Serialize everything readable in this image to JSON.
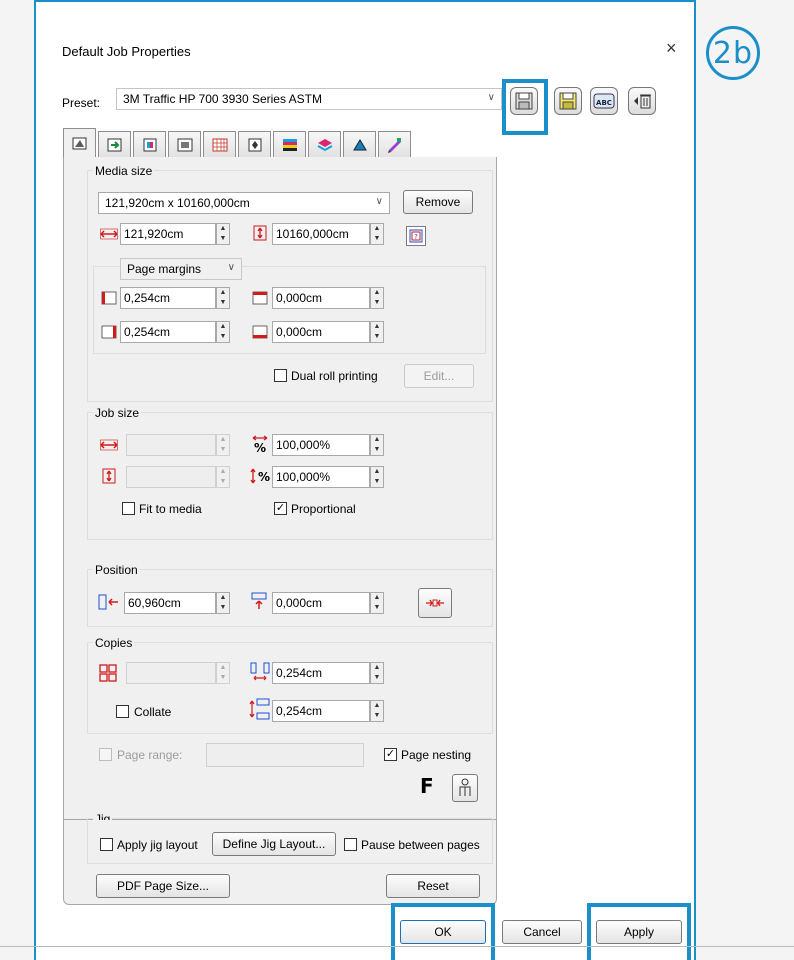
{
  "badge": "2b",
  "dialog": {
    "title": "Default Job Properties",
    "close": "×",
    "preset_label": "Preset:",
    "preset_value": "3M Traffic HP 700 3930 Series ASTM"
  },
  "media_size": {
    "group_label": "Media size",
    "media_select": "121,920cm x 10160,000cm",
    "remove_label": "Remove",
    "width": "121,920cm",
    "height": "10160,000cm",
    "margins_select": "Page margins",
    "margin_left": "0,254cm",
    "margin_top": "0,000cm",
    "margin_right": "0,254cm",
    "margin_bottom": "0,000cm",
    "dual_roll_label": "Dual roll printing",
    "edit_label": "Edit..."
  },
  "job_size": {
    "group_label": "Job size",
    "width": "",
    "height": "",
    "scale_x": "100,000%",
    "scale_y": "100,000%",
    "fit_to_media_label": "Fit to media",
    "fit_to_media_checked": false,
    "proportional_label": "Proportional",
    "proportional_checked": true
  },
  "position": {
    "group_label": "Position",
    "x": "60,960cm",
    "y": "0,000cm"
  },
  "copies": {
    "group_label": "Copies",
    "count": "",
    "spacing_h": "0,254cm",
    "spacing_v": "0,254cm",
    "collate_label": "Collate",
    "collate_checked": false
  },
  "page_range": {
    "label": "Page range:",
    "value": "",
    "nesting_label": "Page nesting",
    "nesting_checked": true,
    "f_glyph": "F"
  },
  "jig": {
    "group_label": "Jig",
    "apply_label": "Apply jig layout",
    "define_label": "Define Jig Layout...",
    "pause_label": "Pause between pages"
  },
  "footer": {
    "pdf_page_size_label": "PDF Page Size...",
    "reset_label": "Reset",
    "ok_label": "OK",
    "cancel_label": "Cancel",
    "apply_label": "Apply"
  },
  "colors": {
    "accent": "#1a8fc9",
    "arrow_red": "#d11a1a",
    "arrow_blue": "#1d4fd6"
  }
}
